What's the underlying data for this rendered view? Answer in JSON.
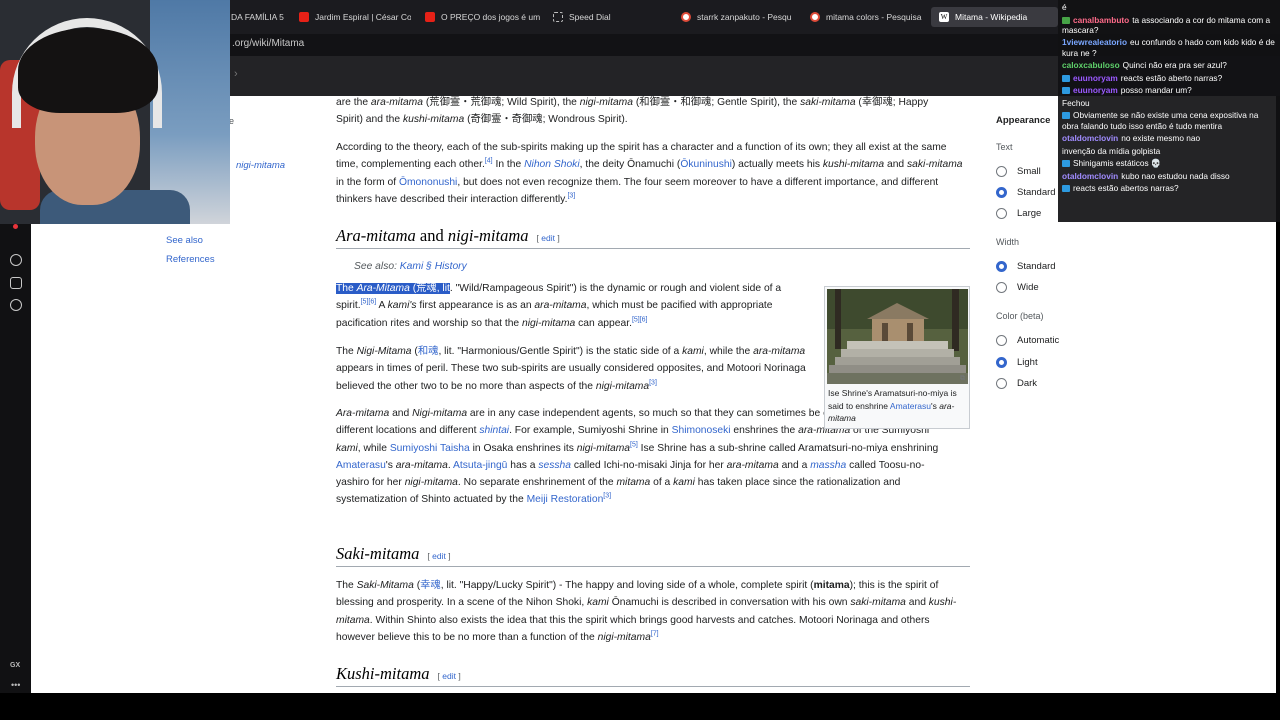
{
  "browser": {
    "tabs": [
      {
        "label": "DA FAMÍLIA 5",
        "icon": "globe-icon",
        "color": "#3a76d8"
      },
      {
        "label": "Jardim Espiral | César Co",
        "icon": "youtube-icon",
        "color": "#e62117"
      },
      {
        "label": "O PREÇO dos jogos é um",
        "icon": "youtube-icon",
        "color": "#e62117"
      },
      {
        "label": "Speed Dial",
        "icon": "speed-dial-icon",
        "color": "#bdbdbd"
      },
      {
        "label": "starrk zanpakuto - Pesqu",
        "icon": "google-icon",
        "color": "#dd4b39"
      },
      {
        "label": "mitama colors - Pesquisa",
        "icon": "google-icon",
        "color": "#dd4b39"
      },
      {
        "label": "Mitama - Wikipedia",
        "icon": "wikipedia-icon",
        "color": "#ffffff"
      }
    ],
    "url": ".org/wiki/Mitama"
  },
  "toc": {
    "e": "e",
    "nigi": "nigi-mitama",
    "items": [
      "See also",
      "References"
    ]
  },
  "article": {
    "p_intro": {
      "line1_a": "are the ",
      "ara": "ara-mitama",
      "line1_b": " (荒御霊・荒御魂; Wild Spirit), the ",
      "nigi": "nigi-mitama",
      "line1_c": " (和御霊・和御魂; Gentle Spirit), the ",
      "saki": "saki-mitama",
      "line1_d": " (幸御魂; Happy",
      "line2_a": "Spirit) and the ",
      "kushi": "kushi-mitama",
      "line2_b": " (奇御霊・奇御魂; Wondrous Spirit)."
    },
    "p_theory": {
      "t1": "According to the theory, each of the sub-spirits making up the spirit has a character and a function of its own; they all exist at the same time, complementing each other.",
      "s1": "[4]",
      "t2": " In the ",
      "link1": "Nihon Shoki",
      "t3": ", the deity Ōnamuchi (",
      "link2": "Ōkuninushi",
      "t4": ") actually meets his ",
      "i1": "kushi-mitama",
      "t5": " and ",
      "i2": "saki-mitama",
      "t6": " in the form of ",
      "link3": "Ōmononushi",
      "t7": ", but does not even recognize them. The four seem moreover to have a different importance, and different thinkers have described their interaction differently.",
      "s2": "[3]"
    },
    "h_ara": {
      "a": "Ara-mitama",
      "and": " and ",
      "b": "nigi-mitama",
      "edit_l": "[ ",
      "edit": "edit",
      "edit_r": " ]"
    },
    "hatnote": {
      "pre": "See also: ",
      "link": "Kami § History"
    },
    "p_ara": {
      "hl1": "The ",
      "hl2": "Ara-Mitama",
      "hl3": " (荒魂, lit",
      "t1": ". \"Wild/Rampageous Spirit\") is the dynamic or rough and violent side of a spirit.",
      "s1": "[5][6]",
      "t2": " A ",
      "i1": "kami's",
      "t3": " first appearance is as an ",
      "i2": "ara-mitama",
      "t4": ", which must be pacified with appropriate pacification rites and worship so that the ",
      "i3": "nigi-mitama",
      "t5": " can appear.",
      "s2": "[5][6]"
    },
    "p_nigi": {
      "t1": "The ",
      "i1": "Nigi-Mitama",
      "t2": " (",
      "cjk": "和魂",
      "t3": ", lit. \"Harmonious/Gentle Spirit\") is the static side of a ",
      "i2": "kami",
      "t4": ", while the ",
      "i3": "ara-mitama",
      "t5": " appears in times of peril. These two sub-spirits are usually considered opposites, and Motoori Norinaga believed the other two to be no more than aspects of the ",
      "i4": "nigi-mitama",
      "s1": "[3]"
    },
    "p_agents": {
      "i1": "Ara-mitama",
      "t1": " and ",
      "i2": "Nigi-mitama",
      "t2": " are in any case independent agents, so much so that they can sometimes be enshrined separately in different locations and different ",
      "l1": "shintai",
      "t3": ". For example, Sumiyoshi Shrine in ",
      "l2": "Shimonoseki",
      "t4": " enshrines the ",
      "i3": "ara-mitama",
      "t5": " of the Sumiyoshi ",
      "i4": "kami",
      "t6": ", while ",
      "l3": "Sumiyoshi Taisha",
      "t7": " in Osaka enshrines its ",
      "i5": "nigi-mitama",
      "s1": "[5]",
      "t8": " Ise Shrine has a sub-shrine called Aramatsuri-no-miya enshrining ",
      "l4": "Amaterasu",
      "t9": "'s ",
      "i6": "ara-mitama",
      "t10": ". ",
      "l5": "Atsuta-jingū",
      "t11": " has a ",
      "l6": "sessha",
      "t12": " called Ichi-no-misaki Jinja for her ",
      "i7": "ara-mitama",
      "t13": " and a ",
      "l7": "massha",
      "t14": " called Toosu-no-yashiro for her ",
      "i8": "nigi-mitama",
      "t15": ". No separate enshrinement of the ",
      "i9": "mitama",
      "t16": " of a ",
      "i10": "kami",
      "t17": " has taken place since the rationalization and systematization of Shinto actuated by the ",
      "l8": "Meiji Restoration",
      "s2": "[3]"
    },
    "h_saki": {
      "a": "Saki-mitama",
      "edit_l": "[ ",
      "edit": "edit",
      "edit_r": " ]"
    },
    "p_saki": {
      "t1": "The ",
      "i1": "Saki-Mitama",
      "t2": " (",
      "cjk": "幸魂",
      "t3": ", lit. \"Happy/Lucky Spirit\") - The happy and loving side of a whole, complete spirit (",
      "b1": "mitama",
      "t4": "); this is the spirit of blessing and prosperity. In a scene of the Nihon Shoki, ",
      "i2": "kami",
      "t5": " Ōnamuchi is described in conversation with his own ",
      "i3": "saki-mitama",
      "t6": " and ",
      "i4": "kushi-mitama",
      "t7": ". Within Shinto also exists the idea that this the spirit which brings good harvests and catches. Motoori Norinaga and others however believe this to be no more than a function of the ",
      "i5": "nigi-mitama",
      "s1": "[7]"
    },
    "h_kushi": {
      "a": "Kushi-mitama",
      "edit_l": "[ ",
      "edit": "edit",
      "edit_r": " ]"
    }
  },
  "figure": {
    "caption_a": "Ise Shrine's Aramatsuri-no-miya is said to enshrine ",
    "caption_link": "Amaterasu",
    "caption_b": "'s ",
    "caption_i": "ara-mitama"
  },
  "appearance": {
    "title": "Appearance",
    "text_label": "Text",
    "text_options": [
      {
        "label": "Small",
        "selected": false
      },
      {
        "label": "Standard",
        "selected": true
      },
      {
        "label": "Large",
        "selected": false
      }
    ],
    "width_label": "Width",
    "width_options": [
      {
        "label": "Standard",
        "selected": true
      },
      {
        "label": "Wide",
        "selected": false
      }
    ],
    "color_label": "Color (beta)",
    "color_options": [
      {
        "label": "Automatic",
        "selected": false
      },
      {
        "label": "Light",
        "selected": true
      },
      {
        "label": "Dark",
        "selected": false
      }
    ]
  },
  "rail": {
    "gx": "GX",
    "dots": "•••"
  },
  "chat": {
    "messages": [
      {
        "user": "",
        "text": "é",
        "color": "#ffffff",
        "badge": ""
      },
      {
        "user": "canalbambuto",
        "text": "ta associando a cor do mitama com a mascara?",
        "color": "#ff6b8a",
        "badge": "#47a447"
      },
      {
        "user": "1viewrealeatorio",
        "text": "eu confundo o hado com kido kido é de kura ne ?",
        "color": "#7aa7ff",
        "badge": ""
      },
      {
        "user": "caloxcabuloso",
        "text": "Quinci não era pra ser azul?",
        "color": "#5fd16b",
        "badge": ""
      },
      {
        "user": "euunoryam",
        "text": "reacts estão aberto narras?",
        "color": "#9b59ff",
        "badge": "#2d9ae0"
      },
      {
        "user": "euunoryam",
        "text": "posso mandar um?",
        "color": "#9b59ff",
        "badge": "#2d9ae0"
      },
      {
        "user": "",
        "text": "Fechou",
        "color": "#b23a3a",
        "badge": ""
      },
      {
        "user": "",
        "text": "Obviamente se não existe uma cena expositiva na obra falando tudo isso então é tudo mentira",
        "color": "#8a5cff",
        "badge": "#2d9ae0"
      },
      {
        "user": "otaldomclovin",
        "text": "no existe mesmo nao",
        "color": "#a18cff",
        "badge": ""
      },
      {
        "user": "",
        "text": "invenção da mídia golpista",
        "color": "#d0453f",
        "badge": ""
      },
      {
        "user": "",
        "text": "Shinigamis estáticos 💀",
        "color": "#d0453f",
        "badge": "#2d9ae0"
      },
      {
        "user": "otaldomclovin",
        "text": "kubo nao estudou nada disso",
        "color": "#a18cff",
        "badge": ""
      },
      {
        "user": "",
        "text": "reacts estão abertos narras?",
        "color": "#8a5cff",
        "badge": "#2d9ae0"
      }
    ]
  }
}
